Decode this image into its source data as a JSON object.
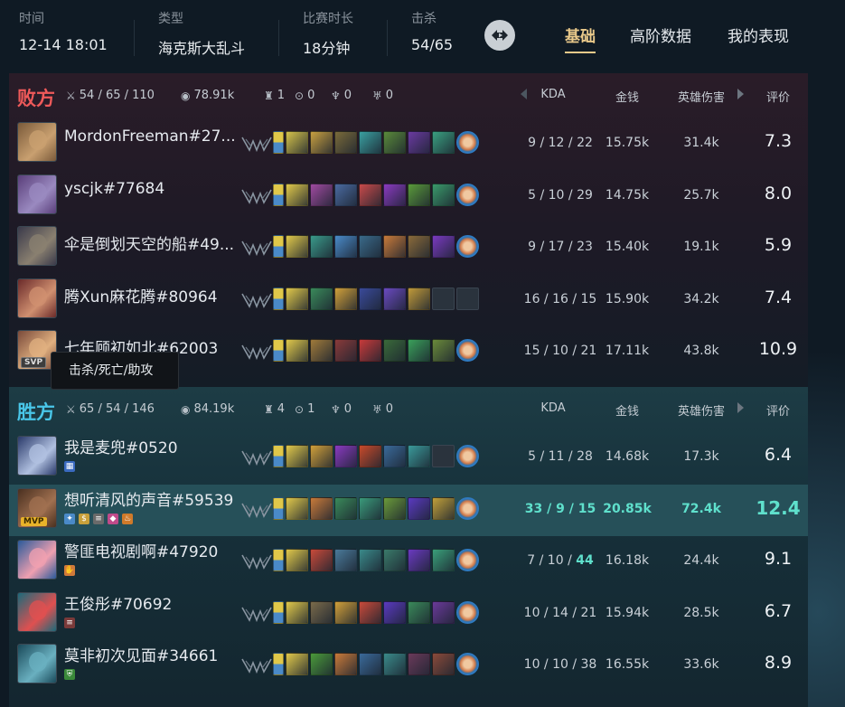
{
  "header": {
    "time_label": "时间",
    "time_value": "12-14 18:01",
    "type_label": "类型",
    "type_value": "海克斯大乱斗",
    "duration_label": "比赛时长",
    "duration_value": "18分钟",
    "kills_label": "击杀",
    "kills_value": "54/65",
    "tabs": [
      "基础",
      "高阶数据",
      "我的表现"
    ],
    "active_tab": "基础"
  },
  "columns": {
    "kda": "KDA",
    "gold": "金钱",
    "damage": "英雄伤害",
    "rating": "评价"
  },
  "teams": [
    {
      "name": "败方",
      "kda": "54 / 65 / 110",
      "gold": "78.91k",
      "towers": "1",
      "barons": "0",
      "dragons": "0",
      "heralds": "0",
      "players": [
        {
          "name": "MordonFreeman#27...",
          "kda": "9 / 12 / 22",
          "gold": "15.75k",
          "damage": "31.4k",
          "score": "7.3",
          "champ_colors": [
            "#7a5a3a",
            "#c9a070"
          ]
        },
        {
          "name": "yscjk#77684",
          "kda": "5 / 10 / 29",
          "gold": "14.75k",
          "damage": "25.7k",
          "score": "8.0",
          "champ_colors": [
            "#5a3e7a",
            "#9a8ac0"
          ]
        },
        {
          "name": "伞是倒划天空的船#49...",
          "kda": "9 / 17 / 23",
          "gold": "15.40k",
          "damage": "19.1k",
          "score": "5.9",
          "champ_colors": [
            "#3a3a4a",
            "#8a8070"
          ]
        },
        {
          "name": "腾Xun麻花腾#80964",
          "kda": "16 / 16 / 15",
          "gold": "15.90k",
          "damage": "34.2k",
          "score": "7.4",
          "champ_colors": [
            "#6a2a2a",
            "#d09070"
          ]
        },
        {
          "name": "七年顾初如北#62003",
          "kda": "15 / 10 / 21",
          "gold": "17.11k",
          "damage": "43.8k",
          "score": "10.9",
          "champ_colors": [
            "#7a4a3a",
            "#e0b080"
          ],
          "tag": "SVP"
        }
      ]
    },
    {
      "name": "胜方",
      "kda": "65 / 54 / 146",
      "gold": "84.19k",
      "towers": "4",
      "barons": "1",
      "dragons": "0",
      "heralds": "0",
      "players": [
        {
          "name": "我是麦兜#0520",
          "kda": "5 / 11 / 28",
          "gold": "14.68k",
          "damage": "17.3k",
          "score": "6.4",
          "champ_colors": [
            "#2a3a6a",
            "#b0c0e0"
          ]
        },
        {
          "name": "想听清风的声音#59539",
          "kda_k": "33",
          "kda_d": "9",
          "kda_a": "15",
          "gold": "20.85k",
          "damage": "72.4k",
          "score": "12.4",
          "champ_colors": [
            "#4a3020",
            "#a07050"
          ],
          "tag": "MVP"
        },
        {
          "name": "警匪电视剧啊#47920",
          "kda_k": "7",
          "kda_d": "10",
          "kda_a": "44",
          "gold": "16.18k",
          "damage": "24.4k",
          "score": "9.1",
          "champ_colors": [
            "#2a5a9a",
            "#f0a0b0"
          ]
        },
        {
          "name": "王俊彤#70692",
          "kda": "10 / 14 / 21",
          "gold": "15.94k",
          "damage": "28.5k",
          "score": "6.7",
          "champ_colors": [
            "#1a6a7a",
            "#e05050"
          ]
        },
        {
          "name": "莫非初次见面#34661",
          "kda": "10 / 10 / 38",
          "gold": "16.55k",
          "damage": "33.6k",
          "score": "8.9",
          "champ_colors": [
            "#1a4a5a",
            "#6ab0c0"
          ]
        }
      ]
    }
  ],
  "tooltip": "击杀/死亡/助攻",
  "colors": {
    "lose": "#ef5a5a",
    "win": "#49c6e8",
    "highlight": "#5fe0cc",
    "active_tab": "#e9c98a"
  }
}
